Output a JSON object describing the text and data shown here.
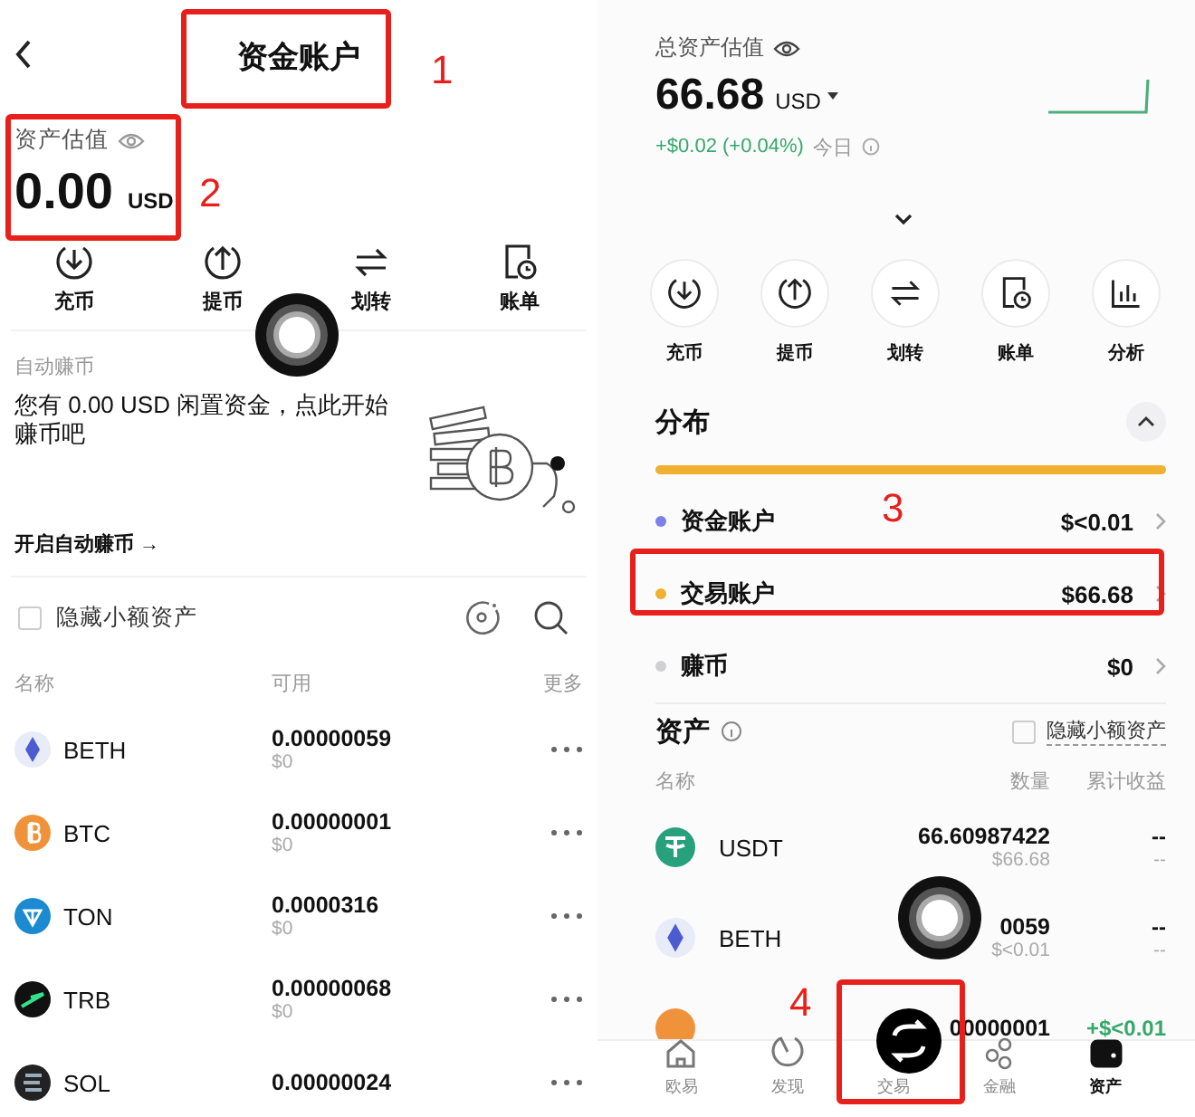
{
  "funding_screen": {
    "title": "资金账户",
    "valuation_label": "资产估值",
    "amount": "0.00",
    "currency": "USD",
    "actions": [
      {
        "label": "充币",
        "kind": "deposit"
      },
      {
        "label": "提币",
        "kind": "withdraw"
      },
      {
        "label": "划转",
        "kind": "transfer"
      },
      {
        "label": "账单",
        "kind": "bill"
      }
    ],
    "auto_earn": {
      "label": "自动赚币",
      "message": "您有 0.00 USD 闲置资金，点此开始赚币吧",
      "link": "开启自动赚币 →"
    },
    "hide_small": {
      "label": "隐藏小额资产",
      "checked": false
    },
    "columns": [
      "名称",
      "可用",
      "更多"
    ],
    "assets": [
      {
        "name": "BETH",
        "kind": "eth",
        "amount": "0.00000059",
        "value": "$0"
      },
      {
        "name": "BTC",
        "kind": "btc",
        "amount": "0.00000001",
        "value": "$0"
      },
      {
        "name": "TON",
        "kind": "ton",
        "amount": "0.0000316",
        "value": "$0"
      },
      {
        "name": "TRB",
        "kind": "trb",
        "amount": "0.00000068",
        "value": "$0"
      },
      {
        "name": "SOL",
        "kind": "sol",
        "amount": "0.00000024"
      }
    ]
  },
  "assets_screen": {
    "total_label": "总资产估值",
    "amount": "66.68",
    "currency": "USD",
    "change": "+$0.02 (+0.04%)",
    "change_period": "今日",
    "actions": [
      {
        "label": "充币",
        "kind": "deposit"
      },
      {
        "label": "提币",
        "kind": "withdraw"
      },
      {
        "label": "划转",
        "kind": "transfer"
      },
      {
        "label": "账单",
        "kind": "bill"
      },
      {
        "label": "分析",
        "kind": "chart"
      }
    ],
    "distribution_title": "分布",
    "accounts": [
      {
        "name": "资金账户",
        "value": "$<0.01",
        "color": "#7d80e6"
      },
      {
        "name": "交易账户",
        "value": "$66.68",
        "color": "#f0b030"
      },
      {
        "name": "赚币",
        "value": "$0",
        "color": "#cfcfd4"
      }
    ],
    "assets_title": "资产",
    "hide_small": {
      "label": "隐藏小额资产",
      "checked": false
    },
    "columns": [
      "名称",
      "数量",
      "累计收益"
    ],
    "assets": [
      {
        "name": "USDT",
        "kind": "usdt",
        "amount": "66.60987422",
        "value": "$66.68",
        "pnl": "--",
        "pnl_sub": "--"
      },
      {
        "name": "BETH",
        "kind": "eth",
        "amount": "0059",
        "value": "$<0.01",
        "pnl": "--",
        "pnl_sub": "--"
      },
      {
        "kind": "btc",
        "amount": "00000001",
        "pnl": "+$<0.01"
      }
    ],
    "nav": [
      {
        "label": "欧易",
        "kind": "home",
        "selected": false
      },
      {
        "label": "发现",
        "kind": "discover",
        "selected": false
      },
      {
        "label": "交易",
        "kind": "trade",
        "selected": false
      },
      {
        "label": "金融",
        "kind": "finance",
        "selected": false
      },
      {
        "label": "资产",
        "kind": "wallet",
        "selected": true
      }
    ]
  },
  "annotations": [
    "1",
    "2",
    "3",
    "4"
  ]
}
